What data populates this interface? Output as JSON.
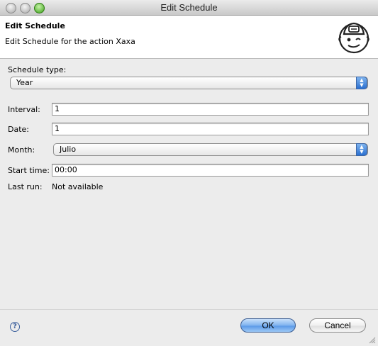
{
  "window": {
    "title": "Edit Schedule"
  },
  "header": {
    "title": "Edit Schedule",
    "description": "Edit Schedule for the action Xaxa"
  },
  "form": {
    "schedule_type": {
      "label": "Schedule type:",
      "value": "Year"
    },
    "interval": {
      "label": "Interval:",
      "value": "1"
    },
    "date": {
      "label": "Date:",
      "value": "1"
    },
    "month": {
      "label": "Month:",
      "value": "Julio"
    },
    "start_time": {
      "label": "Start time:",
      "value": "00:00"
    },
    "last_run": {
      "label": "Last run:",
      "value": "Not available"
    }
  },
  "buttons": {
    "ok": "OK",
    "cancel": "Cancel",
    "help_glyph": "?"
  },
  "icons": {
    "help": "help-icon",
    "mascot": "mascot-icon",
    "resize": "resize-grip-icon"
  },
  "colors": {
    "accent": "#5c9ae8",
    "window_bg": "#ececec",
    "header_bg": "#ffffff"
  }
}
